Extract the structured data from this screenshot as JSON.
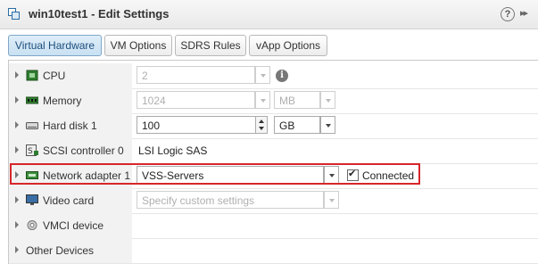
{
  "window": {
    "title": "win10test1 - Edit Settings"
  },
  "tabs": [
    {
      "label": "Virtual Hardware",
      "active": true
    },
    {
      "label": "VM Options",
      "active": false
    },
    {
      "label": "SDRS Rules",
      "active": false
    },
    {
      "label": "vApp Options",
      "active": false
    }
  ],
  "devices": {
    "cpu": {
      "label": "CPU",
      "value": "2",
      "icon": "cpu-icon"
    },
    "memory": {
      "label": "Memory",
      "value": "1024",
      "unit": "MB",
      "icon": "memory-icon"
    },
    "hard_disk": {
      "label": "Hard disk 1",
      "value": "100",
      "unit": "GB",
      "icon": "hard-disk-icon"
    },
    "scsi": {
      "label": "SCSI controller 0",
      "value": "LSI Logic SAS",
      "icon": "scsi-icon"
    },
    "network": {
      "label": "Network adapter 1",
      "value": "VSS-Servers",
      "connected_label": "Connected",
      "connected": true,
      "icon": "network-adapter-icon"
    },
    "video": {
      "label": "Video card",
      "placeholder": "Specify custom settings",
      "icon": "monitor-icon"
    },
    "vmci": {
      "label": "VMCI device",
      "icon": "gear-icon"
    },
    "other": {
      "label": "Other Devices"
    }
  },
  "colors": {
    "highlight": "#d6262b",
    "active_tab": "#c8e0f2"
  }
}
